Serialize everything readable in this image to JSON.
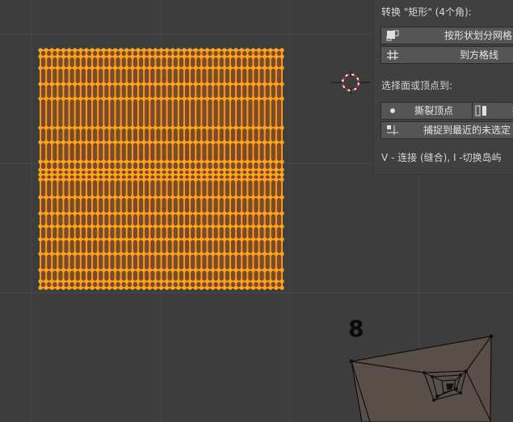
{
  "panel": {
    "convert_heading": "转换 \"矩形\" (4个角):",
    "buttons": {
      "split_by_shape": "按形状划分网格",
      "to_square_grid": "到方格线",
      "rip_vertex": "撕裂顶点",
      "snap_nearest": "捕捉到最近的未选定"
    },
    "select_heading": "选择面或顶点到:",
    "hint": "V - 连接 (缝合), I -切换岛屿"
  },
  "overlay": {
    "number_label": "8"
  },
  "colors": {
    "viewport_bg": "#3d3d3d",
    "grid_line": "#464646",
    "mesh_fill": "#7b4a2d",
    "mesh_edge": "#f59a12",
    "vertex": "#ffa41f",
    "panel_bg": "#404040",
    "button_bg": "#555555"
  }
}
